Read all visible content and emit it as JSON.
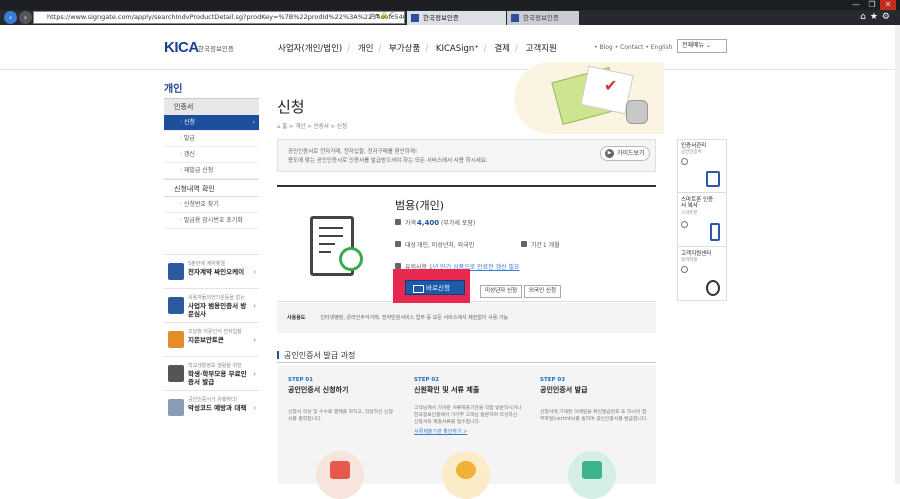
{
  "browser": {
    "url": "https://www.signgate.com/apply/searchIndvProductDetail.sg?prodKey=%7B%22prodId%22%3A%2234defc5406f7e8e02580903",
    "url_controls": "ρ ▾ 🔒 C",
    "tabs": [
      "한국정보인증",
      "한국정보인증"
    ],
    "window_controls": [
      "—",
      "❐",
      "✕"
    ],
    "toolbar_icons": "⌂★⚙"
  },
  "header": {
    "logo": "KICA",
    "logo_sub": "한국정보인증",
    "gnb": [
      "사업자(개인/법인)",
      "개인",
      "부가상품",
      "KICASign⁺",
      "결제",
      "고객지원"
    ],
    "util": "• Blog  • Contact  • English",
    "all_menu": "전체메뉴 ⌄"
  },
  "sidebar": {
    "title": "개인",
    "groups": [
      {
        "label": "인증서",
        "items": [
          "· 신청",
          "· 발급",
          "· 갱신",
          "· 재발급 신청"
        ]
      },
      {
        "label": "신청내역 확인",
        "items": [
          "· 신청번호 찾기",
          "· 발급용 암시번호 초기화"
        ]
      }
    ],
    "banners": [
      {
        "sub": "5분만에 계약체결",
        "title": "전자계약 싸인오케이"
      },
      {
        "sub": "사용자들의안가운등을 없는",
        "title": "사업자 범용인증서 방문심사"
      },
      {
        "sub": "조달청 지문인식 전자입찰",
        "title": "지문보안토큰"
      },
      {
        "sub": "학교생활정보 열람을 위한",
        "title": "학생·학부모용 무료인증서 발급"
      },
      {
        "sub": "공인인증서가 유행하다!",
        "title": "악성코드 예방과 대책"
      }
    ]
  },
  "main": {
    "title": "신청",
    "breadcrumb": "⌂ 홈  >  개인  >  인증서  >  신청",
    "info_lines": [
      "공인인증서로 전자거래, 전자입찰, 전자구매를 편안하게!",
      "용도에 맞는 공인인증서로 인증서를 발급받으셔야 하는 모든 서비스에서 사용 하시세요."
    ],
    "guide_btn": "가이드보기",
    "product": {
      "name": "범용(개인)",
      "price_label": "가격",
      "price_value": "4,400",
      "price_note": "(부가세 포함)",
      "target_label": "대상",
      "target_value": "개인, 미성년자, 외국인",
      "period_label": "기간",
      "period_value": "1 개월",
      "notice_label": "유의사항",
      "notice_value": "1년 만기 상품으로 만료전 갱신 필요",
      "apply_btn": "바로신청",
      "minor_btn": "미성년자 신청",
      "foreign_btn": "외국인 신청"
    },
    "usage_label": "사용용도",
    "usage_text": "인터넷뱅킹, 온라인주식거래, 전자민원서비스 업무 등 모든 서비스에서 제한없이 사용 가능"
  },
  "quick": [
    {
      "title": "인증서관리",
      "sub": "공인인증서"
    },
    {
      "title": "스마트폰 인증서 복사",
      "sub": "스마트폰"
    },
    {
      "title": "고객지원센터",
      "sub": "원격지원"
    }
  ],
  "process": {
    "title": "공인인증서 발급 과정",
    "steps": [
      {
        "no": "STEP 01",
        "title": "공인인증서 신청하기",
        "desc": "신청서 작성 및 수수료 결제를 마치고, 작성하신 신청서를 출력합니다.",
        "link": "",
        "color": "#e55a4a"
      },
      {
        "no": "STEP 02",
        "title": "신원확인 및 서류 제출",
        "desc": "고객님께서 가까운 서류제출기관을 직접 방문하시거나 한국정보인증에서 가기부 고객님 방문하여 작성하신 신청서와 제출서류를 접수합니다.",
        "link": "서류제출기관 확인하기 >",
        "color": "#f2b136"
      },
      {
        "no": "STEP 03",
        "title": "공인인증서 발급",
        "desc": "신청서에 기재된 이메일을 확인발급번호 또 하시어 접부파일(certinfo)를 통하여 공인인증서를 발급합니다.",
        "link": "",
        "color": "#3db489"
      }
    ]
  }
}
